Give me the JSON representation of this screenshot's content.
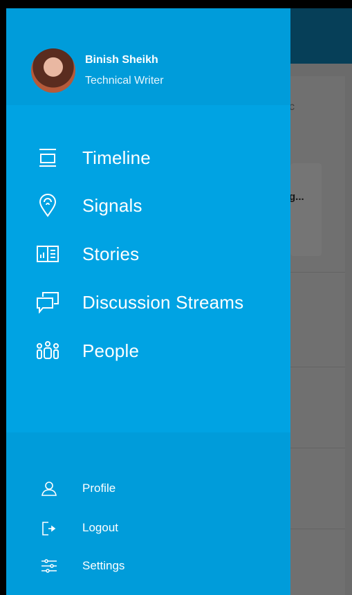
{
  "user": {
    "name": "Binish Sheikh",
    "role": "Technical Writer"
  },
  "nav": [
    {
      "label": "Timeline",
      "icon": "timeline-icon"
    },
    {
      "label": "Signals",
      "icon": "location-pin-icon"
    },
    {
      "label": "Stories",
      "icon": "book-icon"
    },
    {
      "label": "Discussion Streams",
      "icon": "chat-icon"
    },
    {
      "label": "People",
      "icon": "people-icon"
    }
  ],
  "footer": [
    {
      "label": "Profile",
      "icon": "user-icon"
    },
    {
      "label": "Logout",
      "icon": "logout-icon"
    },
    {
      "label": "Settings",
      "icon": "sliders-icon"
    }
  ],
  "background": {
    "partial_text_1": "c",
    "partial_text_2": "g..."
  },
  "colors": {
    "drawer": "#00a3e3",
    "drawer_header": "#009cda",
    "appbar": "#063f58",
    "scrim": "#6b6b6b"
  }
}
